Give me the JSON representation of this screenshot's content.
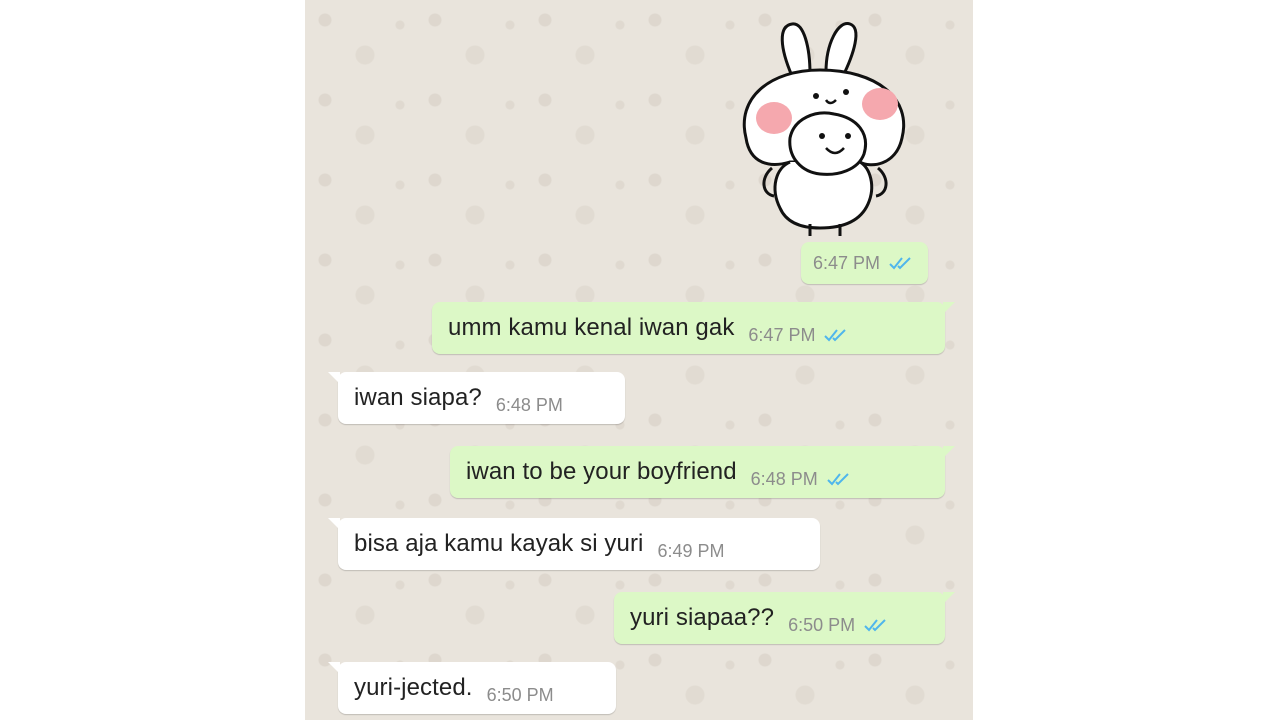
{
  "chat": {
    "sticker": {
      "icon": "bunny-hug-sticker-icon",
      "time": "6:47 PM",
      "status": "read"
    },
    "messages": [
      {
        "direction": "out",
        "text": "umm kamu kenal iwan gak",
        "time": "6:47 PM",
        "status": "read"
      },
      {
        "direction": "in",
        "text": "iwan siapa?",
        "time": "6:48 PM"
      },
      {
        "direction": "out",
        "text": "iwan to be your boyfriend",
        "time": "6:48 PM",
        "status": "read"
      },
      {
        "direction": "in",
        "text": "bisa aja kamu kayak si yuri",
        "time": "6:49 PM"
      },
      {
        "direction": "out",
        "text": "yuri siapaa??",
        "time": "6:50 PM",
        "status": "read"
      },
      {
        "direction": "in",
        "text": "yuri-jected.",
        "time": "6:50 PM"
      }
    ]
  },
  "colors": {
    "outgoing_bubble": "#dcf8c6",
    "incoming_bubble": "#ffffff",
    "chat_background": "#e9e4dc",
    "read_ticks": "#4fb6ec",
    "time_text": "#8c8c8c"
  }
}
